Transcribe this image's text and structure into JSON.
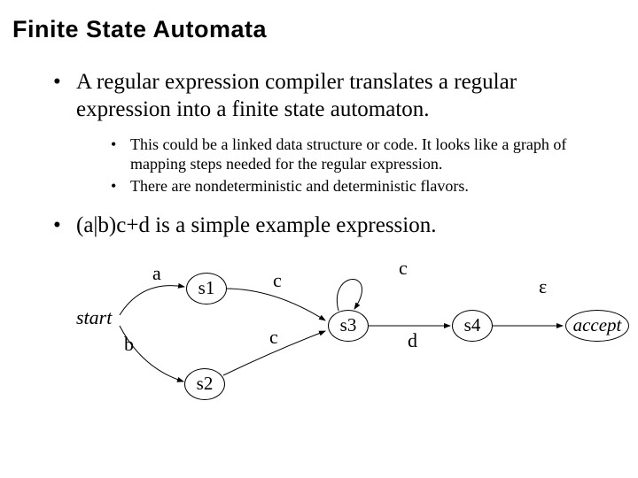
{
  "title": "Finite State Automata",
  "bullets": {
    "b1": "A regular expression compiler translates a regular expression into a finite state automaton.",
    "b1a": "This could be a linked data structure or code. It looks like a graph of mapping steps needed for the regular expression.",
    "b1b": "There are nondeterministic and deterministic flavors.",
    "b2": "(a|b)c+d is a simple example expression."
  },
  "diagram": {
    "start": "start",
    "s1": "s1",
    "s2": "s2",
    "s3": "s3",
    "s4": "s4",
    "accept": "accept",
    "edge_a": "a",
    "edge_b": "b",
    "edge_c1": "c",
    "edge_c2": "c",
    "edge_cloop": "c",
    "edge_d": "d",
    "edge_eps": "ε"
  }
}
